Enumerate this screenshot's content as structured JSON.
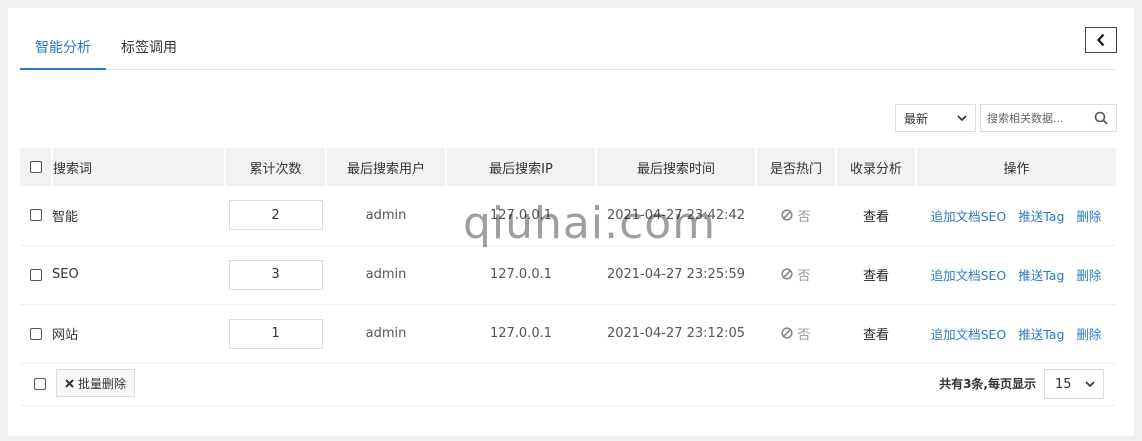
{
  "tabs": [
    {
      "label": "智能分析",
      "active": true
    },
    {
      "label": "标签调用",
      "active": false
    }
  ],
  "filters": {
    "sort_value": "最新",
    "search_placeholder": "搜索相关数据..."
  },
  "table": {
    "headers": [
      "搜索词",
      "累计次数",
      "最后搜索用户",
      "最后搜索IP",
      "最后搜索时间",
      "是否热门",
      "收录分析",
      "操作"
    ],
    "rows": [
      {
        "word": "智能",
        "count": "2",
        "user": "admin",
        "ip": "127.0.0.1",
        "time": "2021-04-27 23:42:42",
        "hot": "否",
        "analysis": "查看"
      },
      {
        "word": "SEO",
        "count": "3",
        "user": "admin",
        "ip": "127.0.0.1",
        "time": "2021-04-27 23:25:59",
        "hot": "否",
        "analysis": "查看"
      },
      {
        "word": "网站",
        "count": "1",
        "user": "admin",
        "ip": "127.0.0.1",
        "time": "2021-04-27 23:12:05",
        "hot": "否",
        "analysis": "查看"
      }
    ],
    "actions": {
      "add_seo": "追加文档SEO",
      "push_tag": "推送Tag",
      "delete": "删除"
    }
  },
  "footer": {
    "batch_delete": "批量删除",
    "summary": "共有3条,每页显示",
    "page_size": "15"
  },
  "watermark": "qiuhai.com",
  "colors": {
    "accent": "#2b7bc4"
  }
}
